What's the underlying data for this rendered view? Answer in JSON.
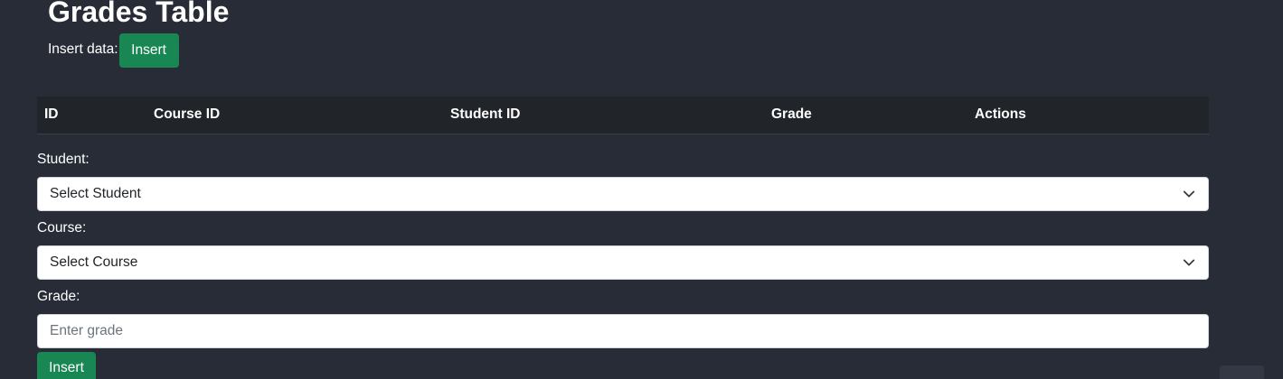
{
  "header": {
    "title": "Grades Table",
    "insert_label": "Insert data:",
    "insert_button": "Insert"
  },
  "table": {
    "columns": [
      "ID",
      "Course ID",
      "Student ID",
      "Grade",
      "Actions"
    ]
  },
  "form": {
    "student_label": "Student:",
    "student_selected": "Select Student",
    "course_label": "Course:",
    "course_selected": "Select Course",
    "grade_label": "Grade:",
    "grade_placeholder": "Enter grade",
    "grade_value": "",
    "submit_button": "Insert"
  },
  "colors": {
    "background": "#282c37",
    "table_header": "#212429",
    "button": "#198754"
  }
}
